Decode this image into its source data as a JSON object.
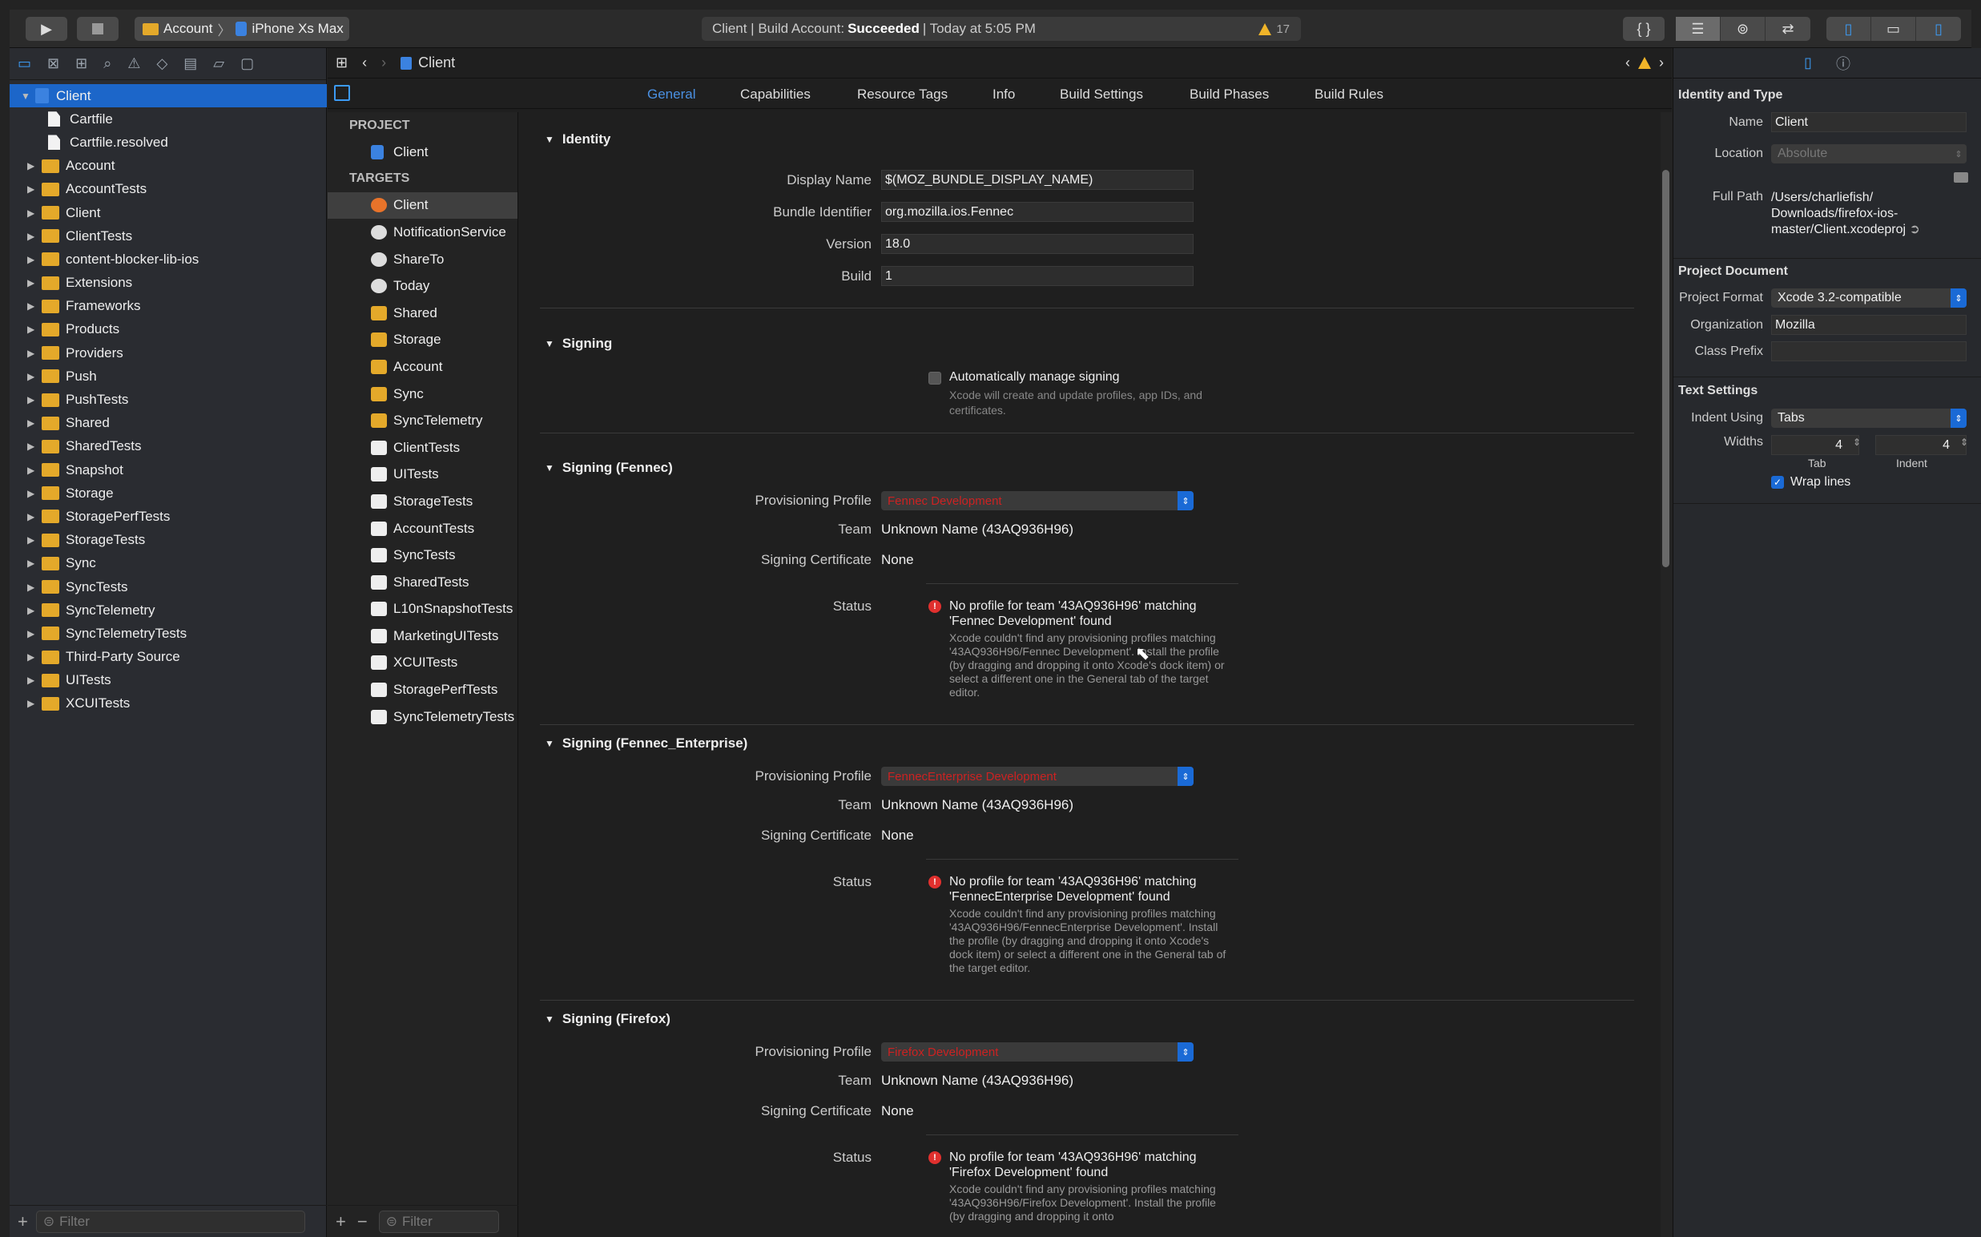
{
  "toolbar": {
    "scheme": "Account",
    "device": "iPhone Xs Max",
    "activity_prefix": "Client | Build Account:",
    "activity_status": "Succeeded",
    "activity_suffix": "| Today at 5:05 PM",
    "warning_count": "17"
  },
  "navigator": {
    "root": "Client",
    "items": [
      {
        "name": "Cartfile",
        "type": "file"
      },
      {
        "name": "Cartfile.resolved",
        "type": "file"
      },
      {
        "name": "Account",
        "type": "folder"
      },
      {
        "name": "AccountTests",
        "type": "folder"
      },
      {
        "name": "Client",
        "type": "folder"
      },
      {
        "name": "ClientTests",
        "type": "folder"
      },
      {
        "name": "content-blocker-lib-ios",
        "type": "folder"
      },
      {
        "name": "Extensions",
        "type": "folder"
      },
      {
        "name": "Frameworks",
        "type": "folder"
      },
      {
        "name": "Products",
        "type": "folder"
      },
      {
        "name": "Providers",
        "type": "folder"
      },
      {
        "name": "Push",
        "type": "folder"
      },
      {
        "name": "PushTests",
        "type": "folder"
      },
      {
        "name": "Shared",
        "type": "folder"
      },
      {
        "name": "SharedTests",
        "type": "folder"
      },
      {
        "name": "Snapshot",
        "type": "folder"
      },
      {
        "name": "Storage",
        "type": "folder"
      },
      {
        "name": "StoragePerfTests",
        "type": "folder"
      },
      {
        "name": "StorageTests",
        "type": "folder"
      },
      {
        "name": "Sync",
        "type": "folder"
      },
      {
        "name": "SyncTests",
        "type": "folder"
      },
      {
        "name": "SyncTelemetry",
        "type": "folder"
      },
      {
        "name": "SyncTelemetryTests",
        "type": "folder"
      },
      {
        "name": "Third-Party Source",
        "type": "folder"
      },
      {
        "name": "UITests",
        "type": "folder"
      },
      {
        "name": "XCUITests",
        "type": "folder"
      }
    ],
    "filter_placeholder": "Filter"
  },
  "editor": {
    "jump_bar": "Client",
    "tabs": [
      "General",
      "Capabilities",
      "Resource Tags",
      "Info",
      "Build Settings",
      "Build Phases",
      "Build Rules"
    ],
    "project_header": "PROJECT",
    "project_item": "Client",
    "targets_header": "TARGETS",
    "targets": [
      {
        "name": "Client",
        "kind": "app"
      },
      {
        "name": "NotificationService",
        "kind": "ext"
      },
      {
        "name": "ShareTo",
        "kind": "ext"
      },
      {
        "name": "Today",
        "kind": "ext"
      },
      {
        "name": "Shared",
        "kind": "fw"
      },
      {
        "name": "Storage",
        "kind": "fw"
      },
      {
        "name": "Account",
        "kind": "fw"
      },
      {
        "name": "Sync",
        "kind": "fw"
      },
      {
        "name": "SyncTelemetry",
        "kind": "fw"
      },
      {
        "name": "ClientTests",
        "kind": "test"
      },
      {
        "name": "UITests",
        "kind": "test"
      },
      {
        "name": "StorageTests",
        "kind": "test"
      },
      {
        "name": "AccountTests",
        "kind": "test"
      },
      {
        "name": "SyncTests",
        "kind": "test"
      },
      {
        "name": "SharedTests",
        "kind": "test"
      },
      {
        "name": "L10nSnapshotTests",
        "kind": "test"
      },
      {
        "name": "MarketingUITests",
        "kind": "test"
      },
      {
        "name": "XCUITests",
        "kind": "test"
      },
      {
        "name": "StoragePerfTests",
        "kind": "test"
      },
      {
        "name": "SyncTelemetryTests",
        "kind": "test"
      }
    ],
    "targets_filter": "Filter",
    "identity": {
      "title": "Identity",
      "display_name_label": "Display Name",
      "display_name": "$(MOZ_BUNDLE_DISPLAY_NAME)",
      "bundle_id_label": "Bundle Identifier",
      "bundle_id": "org.mozilla.ios.Fennec",
      "version_label": "Version",
      "version": "18.0",
      "build_label": "Build",
      "build": "1"
    },
    "signing": {
      "title": "Signing",
      "auto_label": "Automatically manage signing",
      "auto_help": "Xcode will create and update profiles, app IDs, and certificates."
    },
    "signing_sections": [
      {
        "title": "Signing (Fennec)",
        "profile_label": "Provisioning Profile",
        "profile": "Fennec Development",
        "team_label": "Team",
        "team": "Unknown Name (43AQ936H96)",
        "cert_label": "Signing Certificate",
        "cert": "None",
        "status_label": "Status",
        "status_title": "No profile for team '43AQ936H96' matching 'Fennec Development' found",
        "status_detail": "Xcode couldn't find any provisioning profiles matching '43AQ936H96/Fennec Development'. Install the profile (by dragging and dropping it onto Xcode's dock item) or select a different one in the General tab of the target editor."
      },
      {
        "title": "Signing (Fennec_Enterprise)",
        "profile_label": "Provisioning Profile",
        "profile": "FennecEnterprise Development",
        "team_label": "Team",
        "team": "Unknown Name (43AQ936H96)",
        "cert_label": "Signing Certificate",
        "cert": "None",
        "status_label": "Status",
        "status_title": "No profile for team '43AQ936H96' matching 'FennecEnterprise Development' found",
        "status_detail": "Xcode couldn't find any provisioning profiles matching '43AQ936H96/FennecEnterprise Development'. Install the profile (by dragging and dropping it onto Xcode's dock item) or select a different one in the General tab of the target editor."
      },
      {
        "title": "Signing (Firefox)",
        "profile_label": "Provisioning Profile",
        "profile": "Firefox Development",
        "team_label": "Team",
        "team": "Unknown Name (43AQ936H96)",
        "cert_label": "Signing Certificate",
        "cert": "None",
        "status_label": "Status",
        "status_title": "No profile for team '43AQ936H96' matching 'Firefox Development' found",
        "status_detail": "Xcode couldn't find any provisioning profiles matching '43AQ936H96/Firefox Development'. Install the profile (by dragging and dropping it onto"
      }
    ]
  },
  "inspector": {
    "identity_header": "Identity and Type",
    "name_label": "Name",
    "name": "Client",
    "location_label": "Location",
    "location": "Absolute",
    "full_path_label": "Full Path",
    "full_path_1": "/Users/charliefish/",
    "full_path_2": "Downloads/firefox-ios-",
    "full_path_3": "master/Client.xcodeproj",
    "project_doc_header": "Project Document",
    "format_label": "Project Format",
    "format": "Xcode 3.2-compatible",
    "org_label": "Organization",
    "org": "Mozilla",
    "prefix_label": "Class Prefix",
    "prefix": "",
    "text_header": "Text Settings",
    "indent_using_label": "Indent Using",
    "indent_using": "Tabs",
    "widths_label": "Widths",
    "tab_width": "4",
    "indent_width": "4",
    "tab_caption": "Tab",
    "indent_caption": "Indent",
    "wrap_label": "Wrap lines"
  },
  "colors": {
    "accent": "#1c66c9",
    "folder": "#e4a92a",
    "error": "#e0302e",
    "warning": "#f0b429"
  }
}
